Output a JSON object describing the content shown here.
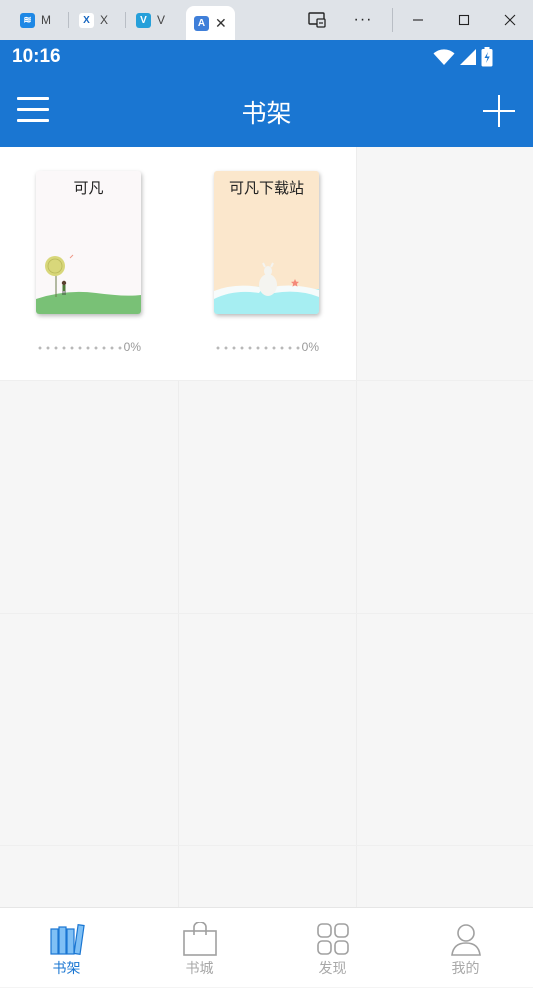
{
  "browser": {
    "tabs": [
      {
        "label": "M",
        "favicon": "maxthon-icon",
        "color": "#1e88e5"
      },
      {
        "label": "X",
        "favicon": "x-icon",
        "color": "#1565c0"
      },
      {
        "label": "V",
        "favicon": "v-icon",
        "color": "#26a0da"
      },
      {
        "label": "A",
        "favicon": "a-icon",
        "color": "#3f7fd9"
      }
    ],
    "controls": {
      "more": "···",
      "minimize": "—",
      "maximize": "☐",
      "close": "✕"
    }
  },
  "status": {
    "time": "10:16"
  },
  "header": {
    "title": "书架"
  },
  "books": [
    {
      "title": "可凡",
      "progress_text": "0%",
      "cover_bg": "#fbf8f9"
    },
    {
      "title": "可凡下载站",
      "progress_text": "0%",
      "cover_bg": "#fbe7cc"
    }
  ],
  "nav": [
    {
      "label": "书架",
      "icon": "bookshelf-icon",
      "active": true
    },
    {
      "label": "书城",
      "icon": "bag-icon",
      "active": false
    },
    {
      "label": "发现",
      "icon": "grid-icon",
      "active": false
    },
    {
      "label": "我的",
      "icon": "person-icon",
      "active": false
    }
  ],
  "colors": {
    "primary": "#1a76d2",
    "inactive": "#a8a8a8"
  }
}
